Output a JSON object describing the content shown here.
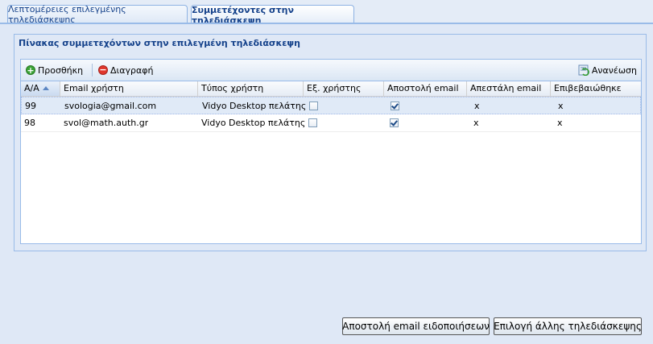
{
  "tabs": [
    {
      "label": "Λεπτομέρειες επιλεγμένης τηλεδιάσκεψης"
    },
    {
      "label": "Συμμετέχοντες στην τηλεδιάσκεψη"
    }
  ],
  "panel": {
    "title": "Πίνακας συμμετεχόντων στην επιλεγμένη τηλεδιάσκεψη"
  },
  "toolbar": {
    "add_label": "Προσθήκη",
    "delete_label": "Διαγραφή",
    "refresh_label": "Ανανέωση"
  },
  "columns": [
    "Α/Α",
    "Email χρήστη",
    "Τύπος χρήστη",
    "Εξ. χρήστης",
    "Αποστολή email",
    "Απεστάλη email",
    "Επιβεβαιώθηκε"
  ],
  "rows": [
    {
      "id": "99",
      "email": "svologia@gmail.com",
      "type": "Vidyo Desktop πελάτης",
      "ext_user": false,
      "send_email": true,
      "email_sent": "x",
      "confirmed": "x"
    },
    {
      "id": "98",
      "email": "svol@math.auth.gr",
      "type": "Vidyo Desktop πελάτης",
      "ext_user": false,
      "send_email": true,
      "email_sent": "x",
      "confirmed": "x"
    }
  ],
  "buttons": {
    "send_notifications": "Αποστολή email ειδοποιήσεων",
    "select_other": "Επιλογή άλλης τηλεδιάσκεψης"
  },
  "colors": {
    "header_blue": "#15428b",
    "panel_bg": "#dfe8f6",
    "border": "#99bbe8"
  }
}
